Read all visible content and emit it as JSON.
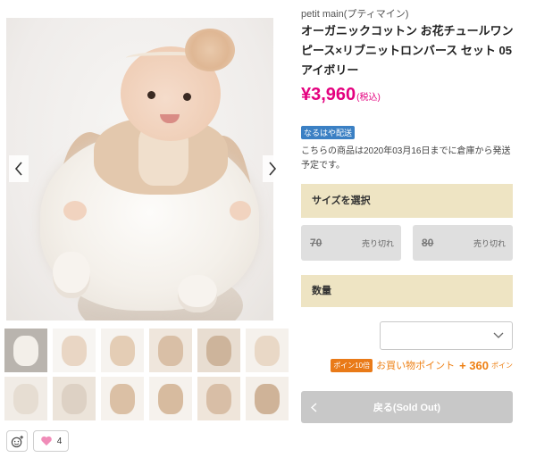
{
  "brand": "petit main(プティマイン)",
  "product": {
    "title": "オーガニックコットン お花チュールワンピース×リブニットロンバース セット 05アイボリー",
    "price": "¥3,960",
    "tax_label": "(税込)"
  },
  "shipping": {
    "badge": "なるはや配送",
    "note": "こちらの商品は2020年03月16日までに倉庫から発送予定です。"
  },
  "size_section": {
    "label": "サイズを選択",
    "options": [
      {
        "size": "70",
        "status": "売り切れ"
      },
      {
        "size": "80",
        "status": "売り切れ"
      }
    ]
  },
  "quantity_section": {
    "label": "数量"
  },
  "points": {
    "badge": "ポイン10倍",
    "label": "お買い物ポイント",
    "value": "+ 360",
    "unit": "ポイン"
  },
  "action_button": {
    "label": "戻る(Sold Out)"
  },
  "reactions": {
    "heart_count": "4"
  },
  "icons": {
    "prev": "chevron-left-icon",
    "next": "chevron-right-icon",
    "select": "chevron-down-icon",
    "emoji": "add-emoji-icon",
    "like": "heart-icon"
  },
  "colors": {
    "price": "#e4007f",
    "section_bg": "#eee4c3",
    "shipping_badge": "#3b80c4",
    "points": "#ee7f12",
    "sold_out_bg": "#dfdfdf",
    "disabled_button": "#c8c8c8"
  },
  "gallery": {
    "thumbnails": [
      {
        "bg": "#b9b4ae",
        "fg": "#f3efe9"
      },
      {
        "bg": "#f7f5f2",
        "fg": "#e9d6c4"
      },
      {
        "bg": "#f6f3ef",
        "fg": "#e4cdb5"
      },
      {
        "bg": "#efe6dc",
        "fg": "#d9bfa6"
      },
      {
        "bg": "#e8ddd1",
        "fg": "#cdb49b"
      },
      {
        "bg": "#f5f1ec",
        "fg": "#e9d8c6"
      },
      {
        "bg": "#f1ece6",
        "fg": "#e6ddd2"
      },
      {
        "bg": "#ece4da",
        "fg": "#ddd1c4"
      },
      {
        "bg": "#f6f2ed",
        "fg": "#dbc0a5"
      },
      {
        "bg": "#f6f2ed",
        "fg": "#d7bb9f"
      },
      {
        "bg": "#efe5da",
        "fg": "#d8bea6"
      },
      {
        "bg": "#f4efe9",
        "fg": "#cfb398"
      }
    ]
  }
}
